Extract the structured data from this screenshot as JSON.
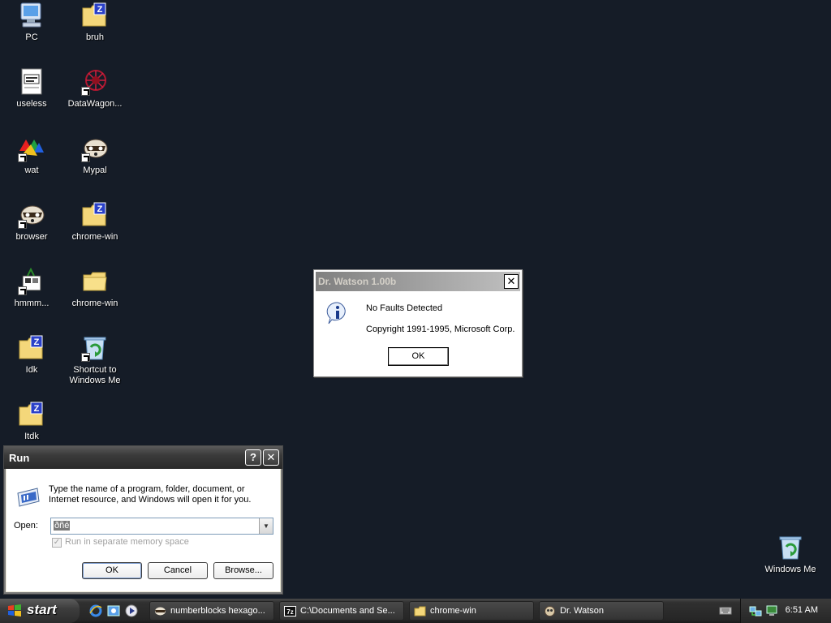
{
  "desktop": {
    "icons": [
      {
        "label": "PC",
        "icon": "computer-icon"
      },
      {
        "label": "bruh",
        "icon": "zip-folder-icon"
      },
      {
        "label": "useless",
        "icon": "document-icon"
      },
      {
        "label": "DataWagon...",
        "icon": "datawagon-icon"
      },
      {
        "label": "wat",
        "icon": "colorful-app-icon"
      },
      {
        "label": "Mypal",
        "icon": "mypal-browser-icon"
      },
      {
        "label": "browser",
        "icon": "mypal-browser-icon"
      },
      {
        "label": "chrome-win",
        "icon": "zip-folder-icon"
      },
      {
        "label": "hmmm...",
        "icon": "app-icon"
      },
      {
        "label": "chrome-win",
        "icon": "folder-icon"
      },
      {
        "label": "Idk",
        "icon": "zip-folder-icon"
      },
      {
        "label": "Shortcut to Windows Me",
        "icon": "recycle-bin-icon"
      },
      {
        "label": "Itdk",
        "icon": "zip-folder-icon"
      },
      {
        "label": "Windows Me",
        "icon": "recycle-bin-icon"
      }
    ]
  },
  "dr_watson": {
    "title": "Dr. Watson 1.00b",
    "close_glyph": "✕",
    "line1": "No Faults Detected",
    "line2": "Copyright 1991-1995, Microsoft Corp.",
    "ok_label": "OK"
  },
  "run_dialog": {
    "title": "Run",
    "help_glyph": "?",
    "close_glyph": "✕",
    "description": "Type the name of a program, folder, document, or Internet resource, and Windows will open it for you.",
    "open_label": "Open:",
    "open_value": "ðñé",
    "dropdown_glyph": "▼",
    "checkbox_label": "Run in separate memory space",
    "checkbox_glyph": "✓",
    "ok_label": "OK",
    "cancel_label": "Cancel",
    "browse_label": "Browse..."
  },
  "taskbar": {
    "start_label": "start",
    "tasks": [
      {
        "label": "numberblocks hexago...",
        "icon": "mypal-browser-icon"
      },
      {
        "label": "C:\\Documents and Se...",
        "icon": "7zip-icon"
      },
      {
        "label": "chrome-win",
        "icon": "folder-icon"
      },
      {
        "label": "Dr. Watson",
        "icon": "dr-watson-icon"
      }
    ],
    "clock": "6:51 AM"
  },
  "colors": {
    "desktop_background": "#151c27",
    "taskbar": "#2c2c2c",
    "folder_yellow": "#f4d77a"
  }
}
